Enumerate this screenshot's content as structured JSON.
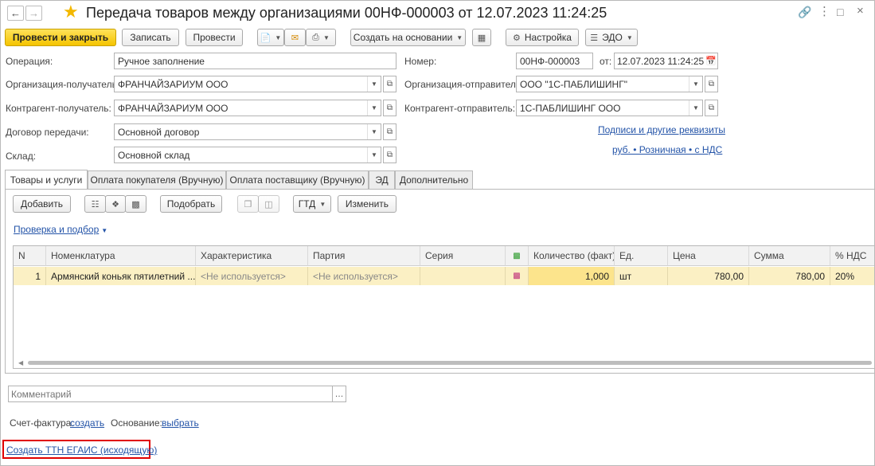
{
  "window": {
    "title": "Передача товаров между организациями 00НФ-000003 от 12.07.2023 11:24:25",
    "icons": [
      "arrow-left-icon",
      "arrow-right-icon",
      "star-icon",
      "link-icon",
      "more-icon",
      "maximize-icon",
      "close-icon"
    ]
  },
  "toolbar": {
    "post_close": "Провести и закрыть",
    "save": "Записать",
    "post": "Провести",
    "create_based": "Создать на основании",
    "settings": "Настройка",
    "edo": "ЭДО"
  },
  "form": {
    "operation_label": "Операция:",
    "operation_value": "Ручное заполнение",
    "number_label": "Номер:",
    "number_value": "00НФ-000003",
    "date_label": "от:",
    "date_value": "12.07.2023 11:24:25",
    "org_receiver_label": "Организация-получатель:",
    "org_receiver_value": "ФРАНЧАЙЗАРИУМ ООО",
    "org_sender_label": "Организация-отправитель:",
    "org_sender_value": "ООО \"1С-ПАБЛИШИНГ\"",
    "contr_receiver_label": "Контрагент-получатель:",
    "contr_receiver_value": "ФРАНЧАЙЗАРИУМ ООО",
    "contr_sender_label": "Контрагент-отправитель:",
    "contr_sender_value": "1С-ПАБЛИШИНГ ООО",
    "contract_label": "Договор передачи:",
    "contract_value": "Основной договор",
    "warehouse_label": "Склад:",
    "warehouse_value": "Основной склад",
    "signatures_link": "Подписи и другие реквизиты",
    "price_link": "руб. • Розничная • с НДС"
  },
  "tabs": [
    {
      "label": "Товары и услуги"
    },
    {
      "label": "Оплата покупателя (Вручную)"
    },
    {
      "label": "Оплата поставщику (Вручную)"
    },
    {
      "label": "ЭД"
    },
    {
      "label": "Дополнительно"
    }
  ],
  "tab_toolbar": {
    "add": "Добавить",
    "pick": "Подобрать",
    "gtd": "ГТД",
    "change": "Изменить",
    "check_link": "Проверка и подбор"
  },
  "table": {
    "columns": [
      "N",
      "Номенклатура",
      "Характеристика",
      "Партия",
      "Серия",
      "Количество (факт)",
      "Ед.",
      "Цена",
      "Сумма",
      "% НДС"
    ],
    "rows": [
      {
        "n": "1",
        "nomenclature": "Армянский коньяк пятилетний ...",
        "characteristic": "<Не используется>",
        "batch": "<Не используется>",
        "series": "",
        "quantity": "1,000",
        "unit": "шт",
        "price": "780,00",
        "sum": "780,00",
        "vat": "20%"
      }
    ]
  },
  "footer": {
    "comment_placeholder": "Комментарий",
    "invoice_label": "Счет-фактура:",
    "invoice_link": "создать",
    "basis_label": "Основание:",
    "basis_link": "выбрать",
    "egais_link": "Создать ТТН ЕГАИС (исходящую)",
    "highlight_color": "#e00000"
  }
}
